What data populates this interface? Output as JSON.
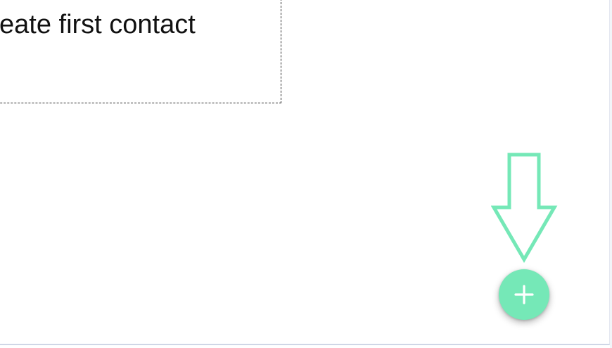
{
  "empty_state": {
    "text": "eate first contact"
  },
  "fab": {
    "icon": "plus-icon"
  },
  "hint": {
    "icon": "down-arrow-icon"
  },
  "colors": {
    "accent": "#75e8b7",
    "text": "#111111",
    "border": "#2a2a2a"
  }
}
